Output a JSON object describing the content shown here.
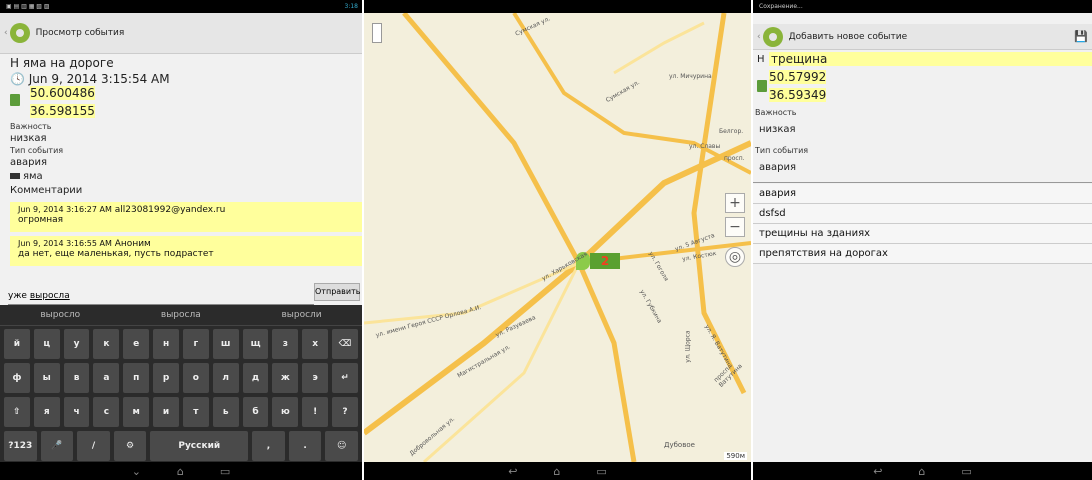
{
  "left": {
    "status_icons": "▣ ▤ ▥ ▦ ▧ ▨",
    "status_right": "3:18",
    "back": "‹",
    "title": "Просмотр события",
    "event_title": "Н яма на дороге",
    "datetime": "Jun 9, 2014 3:15:54 AM",
    "lat": "50.600486",
    "lon": "36.598155",
    "importance_label": "Важность",
    "importance": "низкая",
    "type_label": "Тип события",
    "type": "авария",
    "tag": "яма",
    "comments_label": "Комментарии",
    "comments": [
      {
        "time": "Jun 9, 2014 3:16:27 AM",
        "author": "all23081992@yandex.ru",
        "text": "огромная"
      },
      {
        "time": "Jun 9, 2014 3:16:55 AM",
        "author": "Аноним",
        "text": "да нет, еще маленькая, пусть подрастет"
      }
    ],
    "input_prefix": "уже",
    "input_word": "выросла",
    "send": "Отправить",
    "suggestions": [
      "выросло",
      "выросла",
      "выросли"
    ],
    "keys_row1": [
      "й",
      "ц",
      "у",
      "к",
      "е",
      "н",
      "г",
      "ш",
      "щ",
      "з",
      "х",
      "⌫"
    ],
    "keys_row2": [
      "ф",
      "ы",
      "в",
      "а",
      "п",
      "р",
      "о",
      "л",
      "д",
      "ж",
      "э",
      "↵"
    ],
    "keys_row3": [
      "⇧",
      "я",
      "ч",
      "с",
      "м",
      "и",
      "т",
      "ь",
      "б",
      "ю",
      "!",
      "?"
    ],
    "keys_row4": [
      "?123",
      "🎤",
      "/",
      "⚙",
      "Русский",
      ",",
      ".",
      "☺"
    ]
  },
  "map": {
    "streets": [
      "Сумская ул.",
      "ул. Мичурина",
      "ул. Славы",
      "Белгор.",
      "просп.",
      "ул. 5 Августа",
      "ул. Костюк",
      "ул. Губкина",
      "ул. Гоголя",
      "ул. Я. Ватутина",
      "ул. Харьковская",
      "ул. Щорса",
      "просп. Ватутина",
      "ул. Разуваева",
      "Магистральная ул.",
      "ул. имени Героя СССР Орлова А.И.",
      "Дубовое",
      "Добровольная ул."
    ],
    "marker_count": "2",
    "scale": "590м",
    "zoom_in": "+",
    "zoom_out": "−"
  },
  "right": {
    "status": "Сохранение...",
    "title": "Добавить новое событие",
    "name_prefix": "Н",
    "name": "трещина",
    "lat": "50.57992",
    "lon": "36.59349",
    "importance_label": "Важность",
    "importance": "низкая",
    "type_label": "Тип события",
    "type": "авария",
    "options": [
      "авария",
      "dsfsd",
      "трещины на зданиях",
      "препятствия на дорогах"
    ]
  }
}
